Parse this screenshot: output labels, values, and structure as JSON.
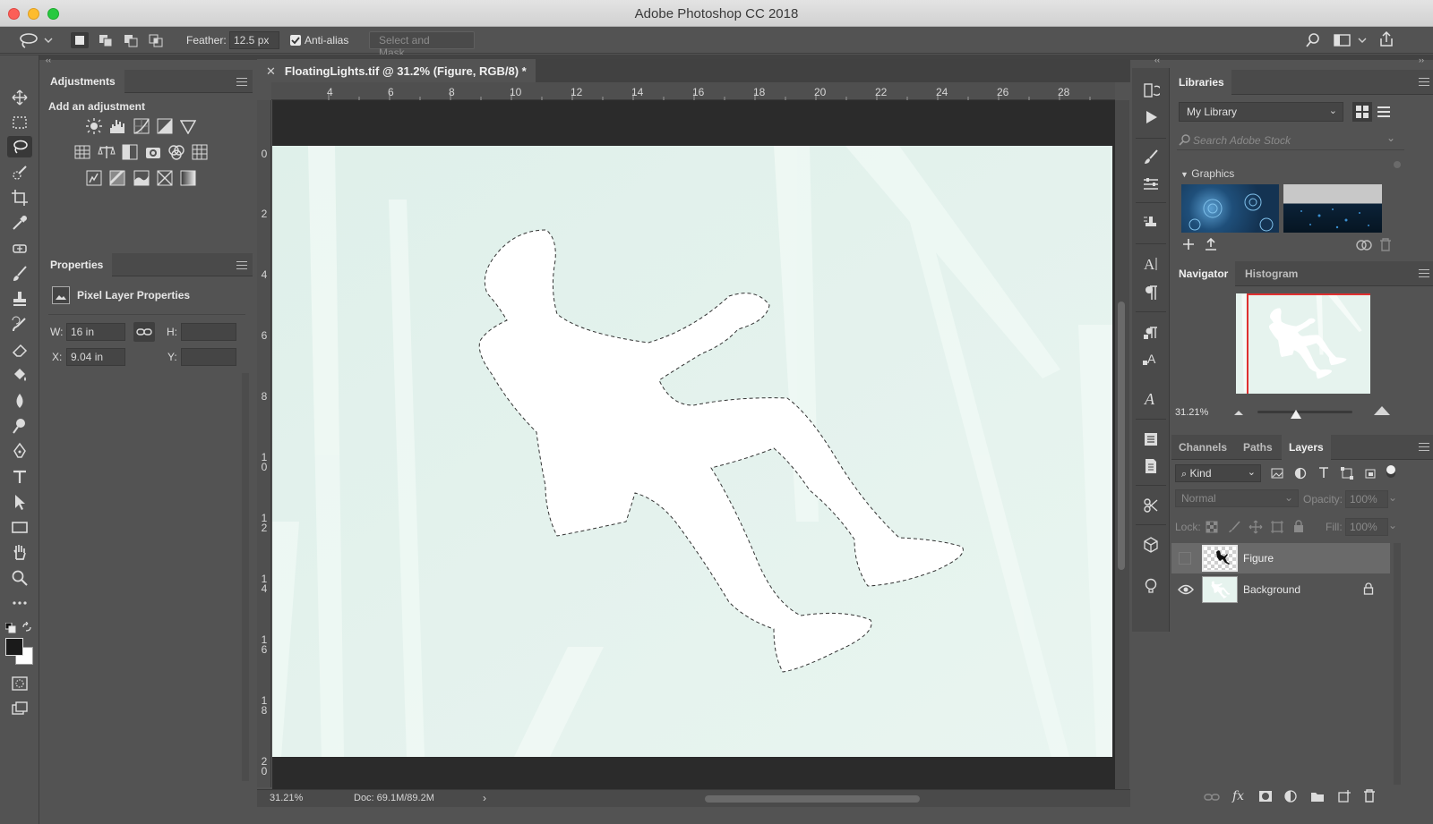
{
  "window": {
    "title": "Adobe Photoshop CC 2018"
  },
  "options_bar": {
    "feather_label": "Feather:",
    "feather_value": "12.5 px",
    "antialias_label": "Anti-alias",
    "antialias_checked": true,
    "select_mask_label": "Select and Mask..."
  },
  "panels_left": {
    "adjustments": {
      "title": "Adjustments",
      "subtitle": "Add an adjustment"
    },
    "properties": {
      "title": "Properties",
      "layer_type": "Pixel Layer Properties",
      "w_label": "W:",
      "w_value": "16 in",
      "h_label": "H:",
      "h_value": "",
      "x_label": "X:",
      "x_value": "9.04 in",
      "y_label": "Y:",
      "y_value": ""
    }
  },
  "document": {
    "tab_title": "FloatingLights.tif @ 31.2% (Figure, RGB/8) *",
    "ruler_h_labels": [
      "4",
      "6",
      "8",
      "10",
      "12",
      "14",
      "16",
      "18",
      "20",
      "22",
      "24",
      "26",
      "28"
    ],
    "ruler_v_labels": [
      "0",
      "2",
      "4",
      "6",
      "8",
      "10",
      "12",
      "14",
      "16",
      "18",
      "20"
    ],
    "status_zoom": "31.21%",
    "status_doc": "Doc: 69.1M/89.2M"
  },
  "panels_right": {
    "libraries": {
      "title": "Libraries",
      "library_name": "My Library",
      "search_placeholder": "Search Adobe Stock",
      "section": "Graphics"
    },
    "navigator": {
      "tabs": [
        "Navigator",
        "Histogram"
      ],
      "zoom": "31.21%"
    },
    "layers": {
      "tabs": [
        "Channels",
        "Paths",
        "Layers"
      ],
      "filter_kind": "Kind",
      "blend_mode": "Normal",
      "opacity_label": "Opacity:",
      "opacity_value": "100%",
      "lock_label": "Lock:",
      "fill_label": "Fill:",
      "fill_value": "100%",
      "items": [
        {
          "name": "Figure",
          "visible": false,
          "selected": true,
          "locked": false
        },
        {
          "name": "Background",
          "visible": true,
          "selected": false,
          "locked": true
        }
      ]
    }
  },
  "colors": {
    "ui_bg": "#535353",
    "canvas_bg": "#e6f3ee",
    "navigator_frame": "#e03030",
    "selection": "#333333"
  }
}
